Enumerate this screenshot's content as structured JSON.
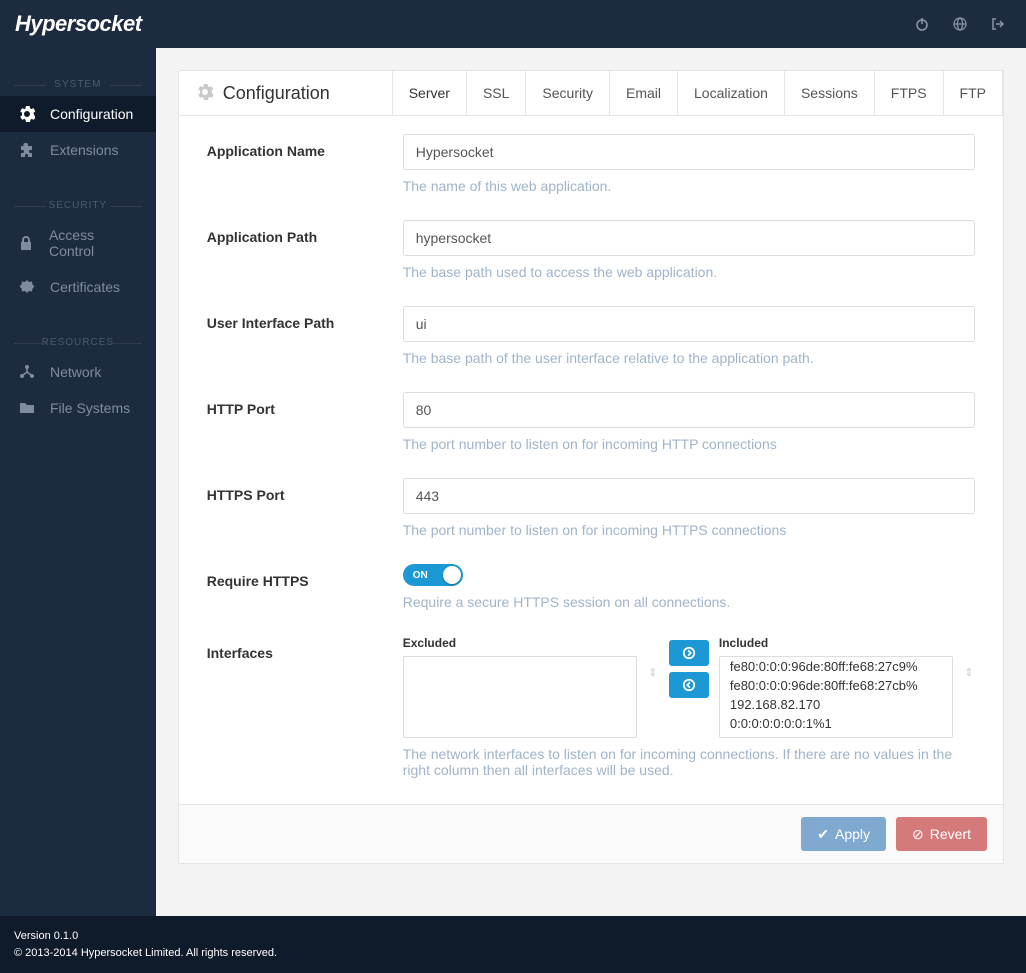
{
  "brand": "Hypersocket",
  "sidebar": {
    "sections": [
      {
        "title": "SYSTEM",
        "items": [
          {
            "label": "Configuration",
            "icon": "gear",
            "active": true
          },
          {
            "label": "Extensions",
            "icon": "puzzle",
            "active": false
          }
        ]
      },
      {
        "title": "SECURITY",
        "items": [
          {
            "label": "Access Control",
            "icon": "lock",
            "active": false
          },
          {
            "label": "Certificates",
            "icon": "cert",
            "active": false
          }
        ]
      },
      {
        "title": "RESOURCES",
        "items": [
          {
            "label": "Network",
            "icon": "network",
            "active": false
          },
          {
            "label": "File Systems",
            "icon": "folder",
            "active": false
          }
        ]
      }
    ]
  },
  "page": {
    "title": "Configuration",
    "tabs": [
      "Server",
      "SSL",
      "Security",
      "Email",
      "Localization",
      "Sessions",
      "FTPS",
      "FTP"
    ],
    "activeTab": "Server"
  },
  "fields": {
    "appName": {
      "label": "Application Name",
      "value": "Hypersocket",
      "help": "The name of this web application."
    },
    "appPath": {
      "label": "Application Path",
      "value": "hypersocket",
      "help": "The base path used to access the web application."
    },
    "uiPath": {
      "label": "User Interface Path",
      "value": "ui",
      "help": "The base path of the user interface relative to the application path."
    },
    "httpPort": {
      "label": "HTTP Port",
      "value": "80",
      "help": "The port number to listen on for incoming HTTP connections"
    },
    "httpsPort": {
      "label": "HTTPS Port",
      "value": "443",
      "help": "The port number to listen on for incoming HTTPS connections"
    },
    "requireHttps": {
      "label": "Require HTTPS",
      "toggle": "ON",
      "help": "Require a secure HTTPS session on all connections."
    },
    "interfaces": {
      "label": "Interfaces",
      "excluded_title": "Excluded",
      "included_title": "Included",
      "excluded": [],
      "included": [
        "fe80:0:0:0:96de:80ff:fe68:27c9%",
        "fe80:0:0:0:96de:80ff:fe68:27cb%",
        "192.168.82.170",
        "0:0:0:0:0:0:0:1%1"
      ],
      "help": "The network interfaces to listen on for incoming connections. If there are no values in the right column then all interfaces will be used."
    }
  },
  "buttons": {
    "apply": "Apply",
    "revert": "Revert"
  },
  "footer": {
    "version": "Version 0.1.0",
    "copyright": "© 2013-2014 Hypersocket Limited. All rights reserved."
  }
}
